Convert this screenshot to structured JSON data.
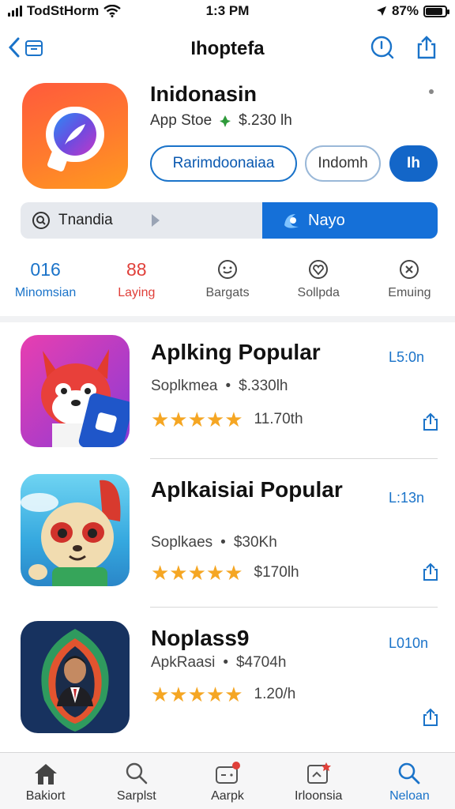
{
  "status": {
    "carrier": "TodStHorm",
    "time": "1:3 PM",
    "battery": "87%",
    "battery_level": 0.87
  },
  "nav": {
    "title": "Ihoptefa"
  },
  "app": {
    "name": "Inidonasin",
    "store": "App Stoe",
    "price": "$.230 lh",
    "buttons": [
      "Rarimdoonaiaa",
      "Indomh",
      "Ih"
    ]
  },
  "segment": {
    "left_label": "Tnandia",
    "right_label": "Nayo"
  },
  "stats": [
    {
      "value": "016",
      "label": "Minomsian",
      "value_color": "#1a73c9",
      "label_color": "#1a73c9"
    },
    {
      "value": "88",
      "label": "Laying",
      "value_color": "#e0403a",
      "label_color": "#e0403a"
    },
    {
      "value": "",
      "label": "Bargats",
      "icon": "smile-icon"
    },
    {
      "value": "",
      "label": "Sollpda",
      "icon": "heart-icon"
    },
    {
      "value": "",
      "label": "Emuing",
      "icon": "close-circle-icon"
    }
  ],
  "list": [
    {
      "title": "Aplking Popular",
      "dev": "Soplkmea",
      "price": "$.330lh",
      "rating": "11.70th",
      "action": "L5:0n",
      "stars": 4.5
    },
    {
      "title": "Aplkaisiai Popular",
      "dev": "Soplkaes",
      "price": "$30Kh",
      "rating": "$170lh",
      "action": "L:13n",
      "stars": 4.5
    },
    {
      "title": "Noplass9",
      "dev": "ApkRaasi",
      "price": "$4704h",
      "rating": "1.20/h",
      "action": "L010n",
      "stars": 4.5
    }
  ],
  "tabs": [
    {
      "label": "Bakiort",
      "icon": "home-icon"
    },
    {
      "label": "Sarplst",
      "icon": "search-icon"
    },
    {
      "label": "Aarpk",
      "icon": "games-icon"
    },
    {
      "label": "Irloonsia",
      "icon": "apps-icon"
    },
    {
      "label": "Neloan",
      "icon": "search-icon",
      "active": true
    }
  ],
  "colors": {
    "accent": "#1a73c9",
    "brand_orange": "#ff6a2f",
    "star": "#f5a623"
  }
}
